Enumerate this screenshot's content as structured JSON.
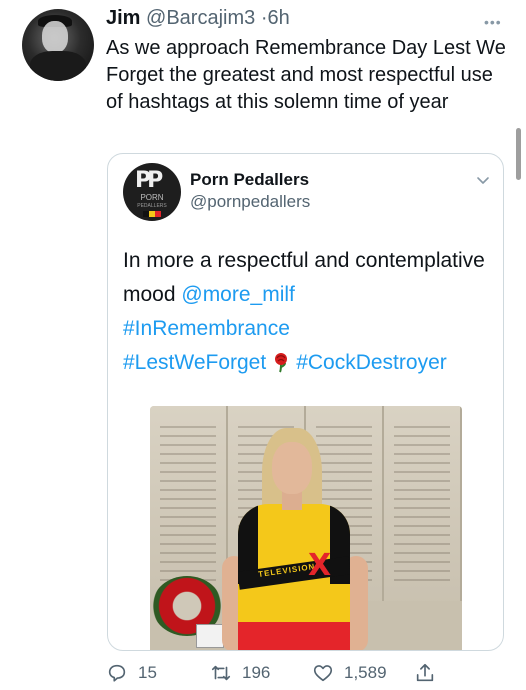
{
  "tweet": {
    "author_name": "Jim",
    "author_handle": "@Barcajim3",
    "separator": "·",
    "time": "6h",
    "more_icon": "more-dots-icon",
    "text": "As we approach Remembrance Day Lest We Forget the greatest and most respectful use of hashtags at this solemn time of year"
  },
  "quote": {
    "author_name": "Porn Pedallers",
    "author_handle": "@pornpedallers",
    "avatar_text_top": "PORN",
    "avatar_text_bottom": "PEDALLERS",
    "avatar_monogram": "PP",
    "text_intro": "In more a respectful and contemplative mood ",
    "mention": "@more_milf",
    "hashtags": [
      "#InRemembrance",
      "#LestWeForget",
      "#CockDestroyer"
    ],
    "emoji_icon": "rose-icon",
    "image": {
      "jersey_label": "TELEVISION",
      "jersey_mark": "X"
    }
  },
  "actions": {
    "reply_count": "15",
    "retweet_count": "196",
    "like_count": "1,589"
  },
  "colors": {
    "link": "#1d9bf0",
    "text": "#0f1419",
    "secondary": "#536471",
    "border": "#cfd9de"
  }
}
